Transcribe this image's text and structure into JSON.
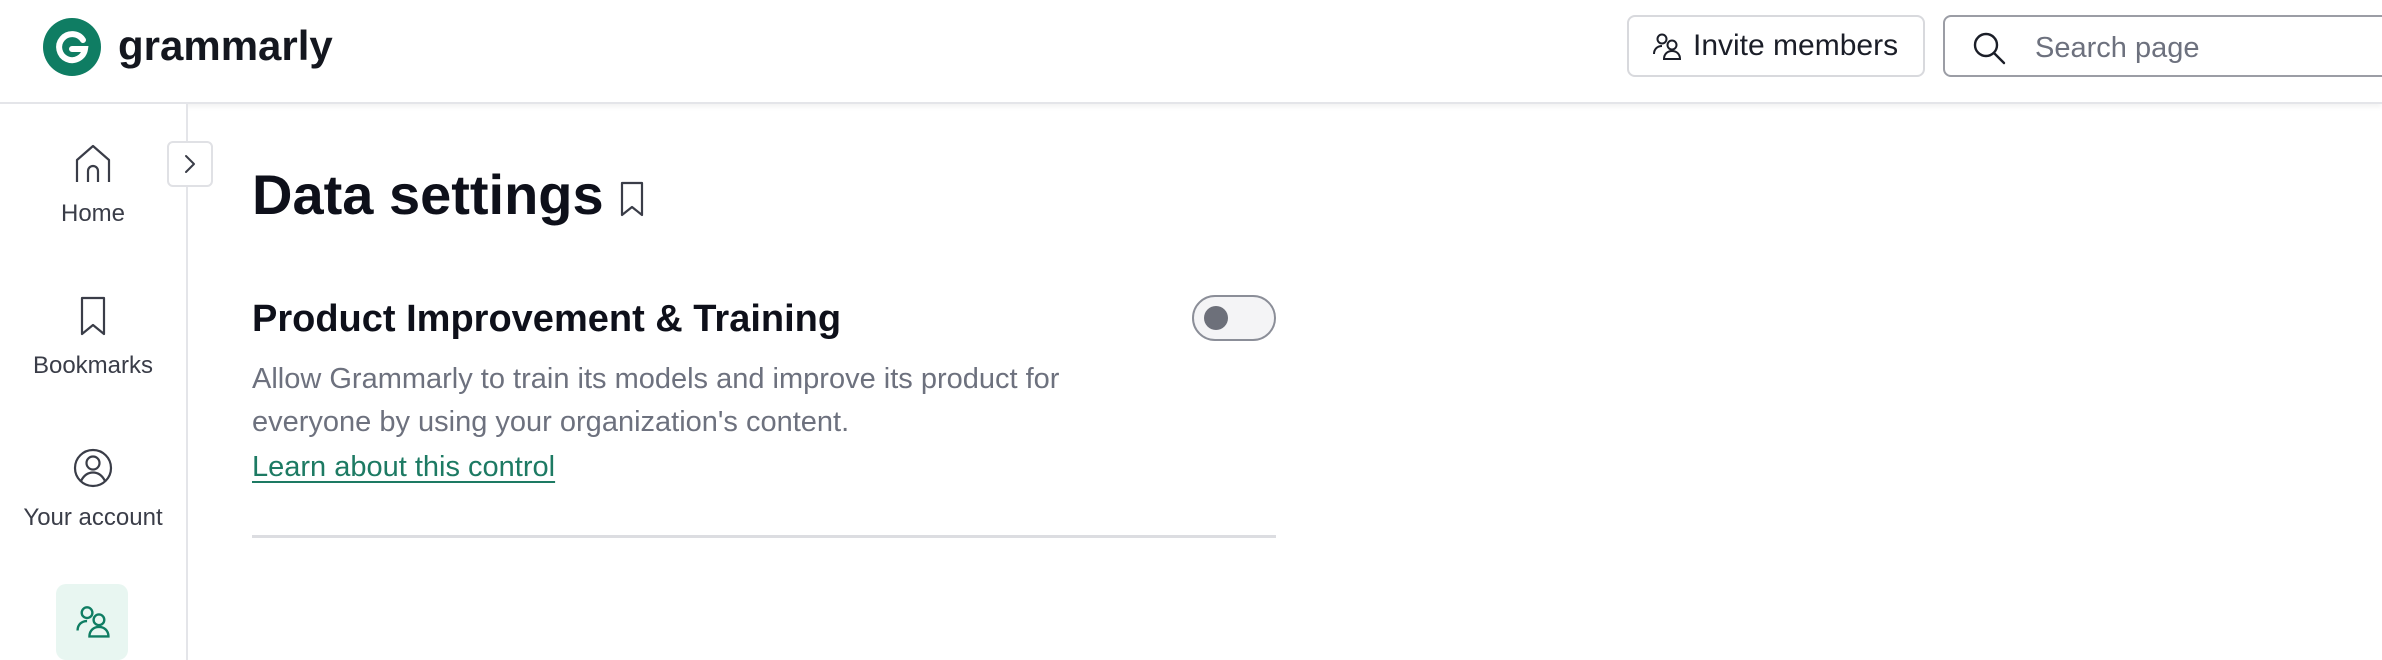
{
  "header": {
    "logo_text": "grammarly",
    "invite_label": "Invite members",
    "search_placeholder": "Search page"
  },
  "sidebar": {
    "items": [
      {
        "label": "Home",
        "icon": "home-icon"
      },
      {
        "label": "Bookmarks",
        "icon": "bookmark-icon"
      },
      {
        "label": "Your account",
        "icon": "account-icon"
      },
      {
        "label": "",
        "icon": "members-icon",
        "active": true
      }
    ]
  },
  "main": {
    "title": "Data settings",
    "section": {
      "title": "Product Improvement & Training",
      "description": "Allow Grammarly to train its models and improve its product for everyone by using your organization's content.",
      "link_text": "Learn about this control",
      "toggle_on": false
    }
  },
  "colors": {
    "brand": "#15c39a",
    "logo_bg": "#0f7d63",
    "link": "#1d7a63",
    "active_nav_bg": "#e8f6f1"
  }
}
